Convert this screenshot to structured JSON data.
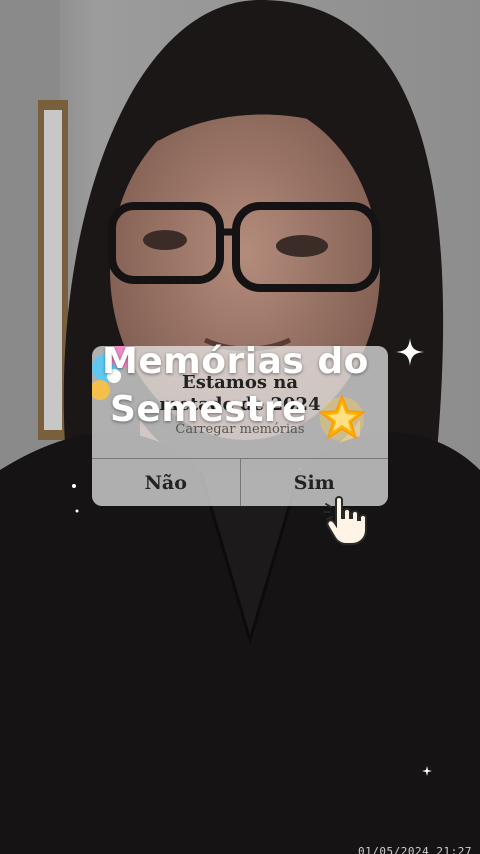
{
  "overlay": {
    "title_line1": "Memórias do",
    "title_line2": "Semestre"
  },
  "dialog": {
    "message_line1": "Estamos na",
    "message_line2": "metade de 2024",
    "subtitle": "Carregar memórias",
    "no_label": "Não",
    "yes_label": "Sim"
  },
  "timestamp": "01/05/2024 21:27",
  "icons": {
    "star": "glowing-star-icon",
    "hand": "pointing-hand-icon",
    "sparkle": "sparkle-icon"
  },
  "colors": {
    "dialog_bg": "#ececec",
    "title_text": "#ffffff",
    "flower_accent": "#5ec8f0"
  }
}
